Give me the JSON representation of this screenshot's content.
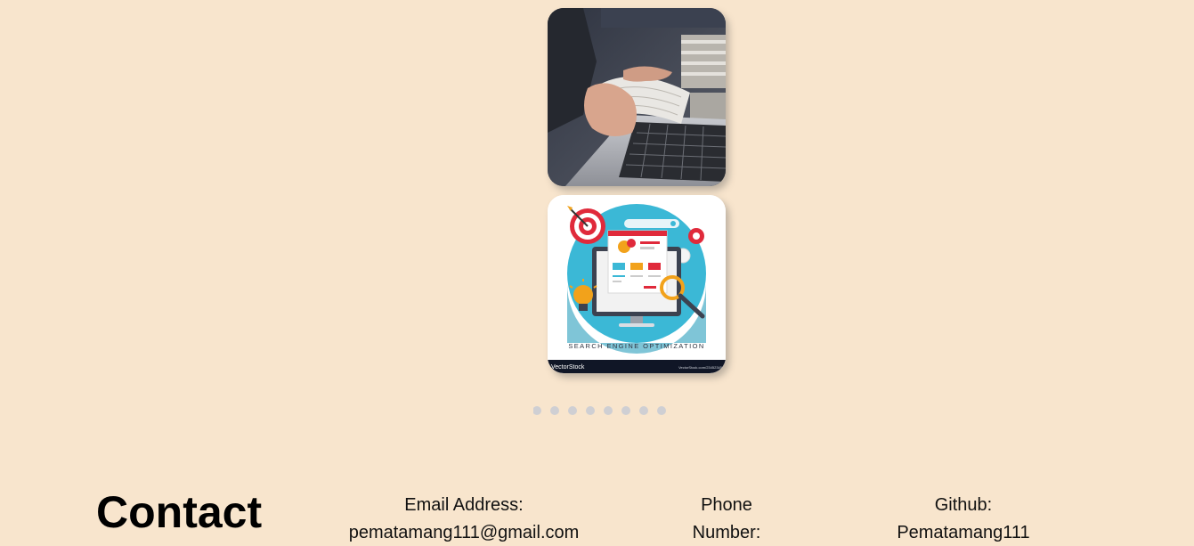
{
  "gallery": {
    "images": [
      {
        "name": "laptop-reading-photo",
        "alt": "Person reading a book at a laptop"
      },
      {
        "name": "seo-illustration",
        "caption": "SEARCH ENGINE OPTIMIZATION",
        "watermark_left": "VectorStock",
        "watermark_right": "VectorStock.com/23452345"
      }
    ],
    "dots_count": 8,
    "active_dot": 0
  },
  "contact": {
    "heading": "Contact",
    "email_label": "Email Address:",
    "email_value": "pematamang111@gmail.com",
    "phone_label_line1": "Phone",
    "phone_label_line2": "Number:",
    "github_label": "Github:",
    "github_value": "Pematamang111"
  },
  "colors": {
    "background": "#f8e5cd",
    "dot": "#cfcfd3"
  }
}
